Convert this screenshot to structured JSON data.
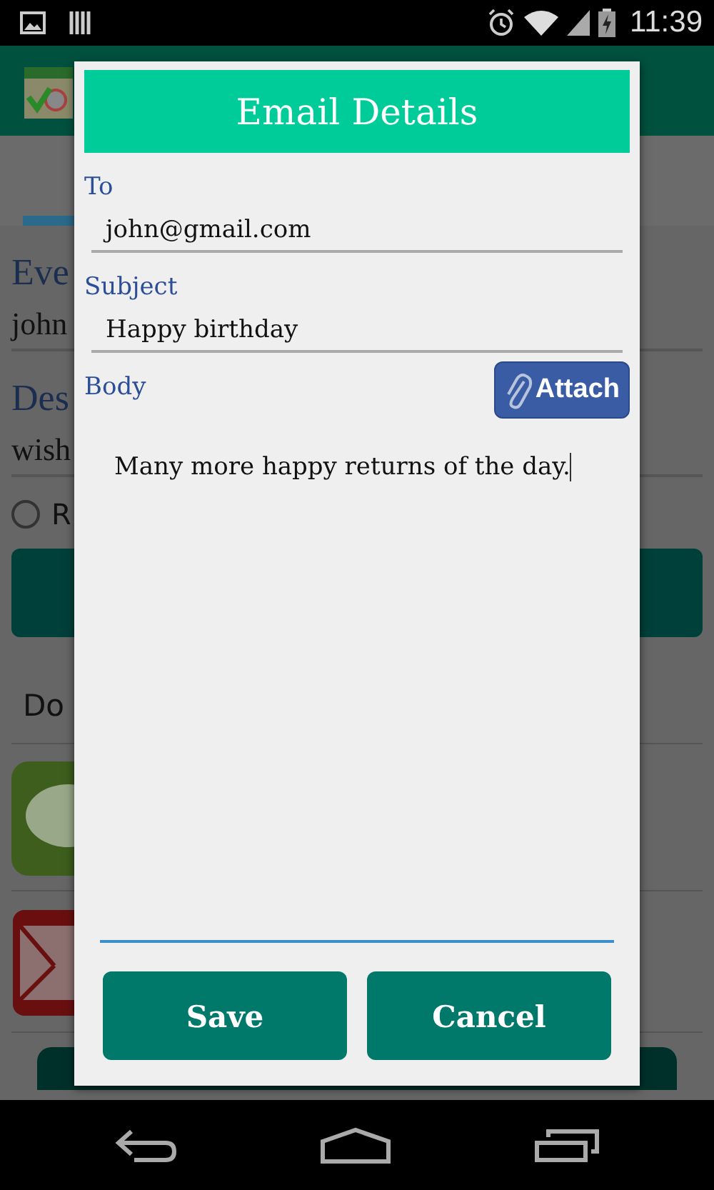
{
  "status_bar": {
    "time": "11:39"
  },
  "background_screen": {
    "event_label": "Eve",
    "event_value": "john",
    "description_label": "Des",
    "description_value": "wish",
    "radio_label": "R",
    "radio_checked": false,
    "spinner_value": "Do"
  },
  "dialog": {
    "title": "Email Details",
    "fields": [
      {
        "label": "To",
        "value": "john@gmail.com"
      },
      {
        "label": "Subject",
        "value": "Happy birthday"
      }
    ],
    "body": {
      "label": "Body",
      "value": "Many more happy returns of the day."
    },
    "attach_button": "Attach",
    "buttons": [
      "Save",
      "Cancel"
    ]
  }
}
